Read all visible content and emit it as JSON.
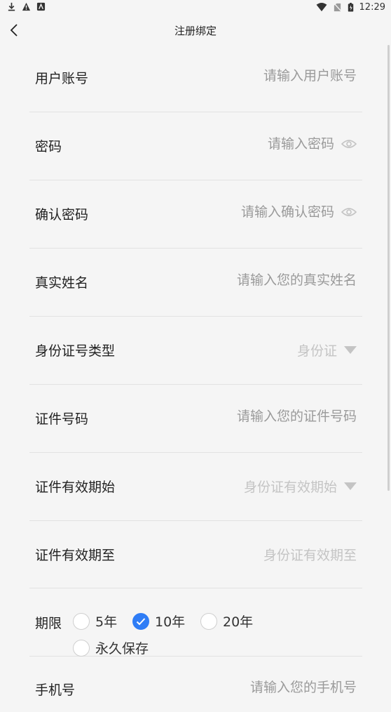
{
  "status": {
    "time": "12:29"
  },
  "nav": {
    "title": "注册绑定"
  },
  "fields": [
    {
      "label": "用户账号",
      "placeholder": "请输入用户账号"
    },
    {
      "label": "密码",
      "placeholder": "请输入密码"
    },
    {
      "label": "确认密码",
      "placeholder": "请输入确认密码"
    },
    {
      "label": "真实姓名",
      "placeholder": "请输入您的真实姓名"
    },
    {
      "label": "身份证号类型",
      "value": "身份证"
    },
    {
      "label": "证件号码",
      "placeholder": "请输入您的证件号码"
    },
    {
      "label": "证件有效期始",
      "placeholder": "身份证有效期始"
    },
    {
      "label": "证件有效期至",
      "placeholder": "身份证有效期至"
    },
    {
      "label": "手机号",
      "placeholder": "请输入您的手机号"
    }
  ],
  "term": {
    "label": "期限",
    "options": [
      "5年",
      "10年",
      "20年",
      "永久保存"
    ],
    "selected": "10年"
  },
  "colors": {
    "accent": "#2f7df6",
    "placeholder": "#9a9a9a",
    "divider": "#e2e2e2"
  },
  "icons": [
    "download-icon",
    "warning-icon",
    "notification-icon",
    "wifi-icon",
    "sim-icon",
    "battery-icon",
    "back-arrow-icon",
    "eye-icon",
    "dropdown-triangle-icon",
    "check-icon"
  ]
}
